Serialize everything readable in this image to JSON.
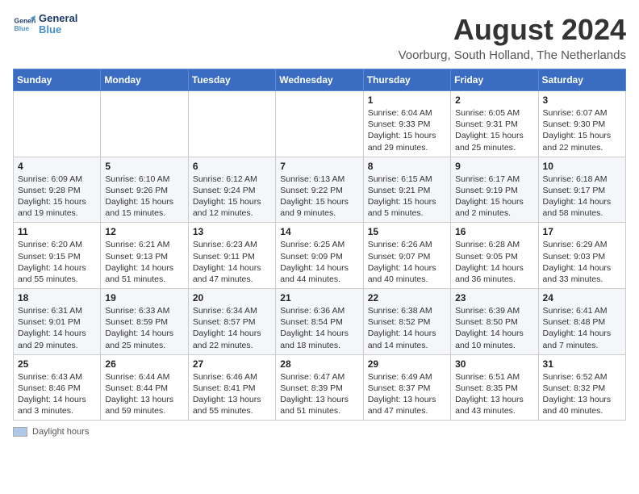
{
  "header": {
    "logo_line1": "General",
    "logo_line2": "Blue",
    "month_year": "August 2024",
    "location": "Voorburg, South Holland, The Netherlands"
  },
  "columns": [
    "Sunday",
    "Monday",
    "Tuesday",
    "Wednesday",
    "Thursday",
    "Friday",
    "Saturday"
  ],
  "weeks": [
    [
      {
        "day": "",
        "info": ""
      },
      {
        "day": "",
        "info": ""
      },
      {
        "day": "",
        "info": ""
      },
      {
        "day": "",
        "info": ""
      },
      {
        "day": "1",
        "info": "Sunrise: 6:04 AM\nSunset: 9:33 PM\nDaylight: 15 hours and 29 minutes."
      },
      {
        "day": "2",
        "info": "Sunrise: 6:05 AM\nSunset: 9:31 PM\nDaylight: 15 hours and 25 minutes."
      },
      {
        "day": "3",
        "info": "Sunrise: 6:07 AM\nSunset: 9:30 PM\nDaylight: 15 hours and 22 minutes."
      }
    ],
    [
      {
        "day": "4",
        "info": "Sunrise: 6:09 AM\nSunset: 9:28 PM\nDaylight: 15 hours and 19 minutes."
      },
      {
        "day": "5",
        "info": "Sunrise: 6:10 AM\nSunset: 9:26 PM\nDaylight: 15 hours and 15 minutes."
      },
      {
        "day": "6",
        "info": "Sunrise: 6:12 AM\nSunset: 9:24 PM\nDaylight: 15 hours and 12 minutes."
      },
      {
        "day": "7",
        "info": "Sunrise: 6:13 AM\nSunset: 9:22 PM\nDaylight: 15 hours and 9 minutes."
      },
      {
        "day": "8",
        "info": "Sunrise: 6:15 AM\nSunset: 9:21 PM\nDaylight: 15 hours and 5 minutes."
      },
      {
        "day": "9",
        "info": "Sunrise: 6:17 AM\nSunset: 9:19 PM\nDaylight: 15 hours and 2 minutes."
      },
      {
        "day": "10",
        "info": "Sunrise: 6:18 AM\nSunset: 9:17 PM\nDaylight: 14 hours and 58 minutes."
      }
    ],
    [
      {
        "day": "11",
        "info": "Sunrise: 6:20 AM\nSunset: 9:15 PM\nDaylight: 14 hours and 55 minutes."
      },
      {
        "day": "12",
        "info": "Sunrise: 6:21 AM\nSunset: 9:13 PM\nDaylight: 14 hours and 51 minutes."
      },
      {
        "day": "13",
        "info": "Sunrise: 6:23 AM\nSunset: 9:11 PM\nDaylight: 14 hours and 47 minutes."
      },
      {
        "day": "14",
        "info": "Sunrise: 6:25 AM\nSunset: 9:09 PM\nDaylight: 14 hours and 44 minutes."
      },
      {
        "day": "15",
        "info": "Sunrise: 6:26 AM\nSunset: 9:07 PM\nDaylight: 14 hours and 40 minutes."
      },
      {
        "day": "16",
        "info": "Sunrise: 6:28 AM\nSunset: 9:05 PM\nDaylight: 14 hours and 36 minutes."
      },
      {
        "day": "17",
        "info": "Sunrise: 6:29 AM\nSunset: 9:03 PM\nDaylight: 14 hours and 33 minutes."
      }
    ],
    [
      {
        "day": "18",
        "info": "Sunrise: 6:31 AM\nSunset: 9:01 PM\nDaylight: 14 hours and 29 minutes."
      },
      {
        "day": "19",
        "info": "Sunrise: 6:33 AM\nSunset: 8:59 PM\nDaylight: 14 hours and 25 minutes."
      },
      {
        "day": "20",
        "info": "Sunrise: 6:34 AM\nSunset: 8:57 PM\nDaylight: 14 hours and 22 minutes."
      },
      {
        "day": "21",
        "info": "Sunrise: 6:36 AM\nSunset: 8:54 PM\nDaylight: 14 hours and 18 minutes."
      },
      {
        "day": "22",
        "info": "Sunrise: 6:38 AM\nSunset: 8:52 PM\nDaylight: 14 hours and 14 minutes."
      },
      {
        "day": "23",
        "info": "Sunrise: 6:39 AM\nSunset: 8:50 PM\nDaylight: 14 hours and 10 minutes."
      },
      {
        "day": "24",
        "info": "Sunrise: 6:41 AM\nSunset: 8:48 PM\nDaylight: 14 hours and 7 minutes."
      }
    ],
    [
      {
        "day": "25",
        "info": "Sunrise: 6:43 AM\nSunset: 8:46 PM\nDaylight: 14 hours and 3 minutes."
      },
      {
        "day": "26",
        "info": "Sunrise: 6:44 AM\nSunset: 8:44 PM\nDaylight: 13 hours and 59 minutes."
      },
      {
        "day": "27",
        "info": "Sunrise: 6:46 AM\nSunset: 8:41 PM\nDaylight: 13 hours and 55 minutes."
      },
      {
        "day": "28",
        "info": "Sunrise: 6:47 AM\nSunset: 8:39 PM\nDaylight: 13 hours and 51 minutes."
      },
      {
        "day": "29",
        "info": "Sunrise: 6:49 AM\nSunset: 8:37 PM\nDaylight: 13 hours and 47 minutes."
      },
      {
        "day": "30",
        "info": "Sunrise: 6:51 AM\nSunset: 8:35 PM\nDaylight: 13 hours and 43 minutes."
      },
      {
        "day": "31",
        "info": "Sunrise: 6:52 AM\nSunset: 8:32 PM\nDaylight: 13 hours and 40 minutes."
      }
    ]
  ],
  "legend": {
    "daylight_hours_label": "Daylight hours"
  }
}
